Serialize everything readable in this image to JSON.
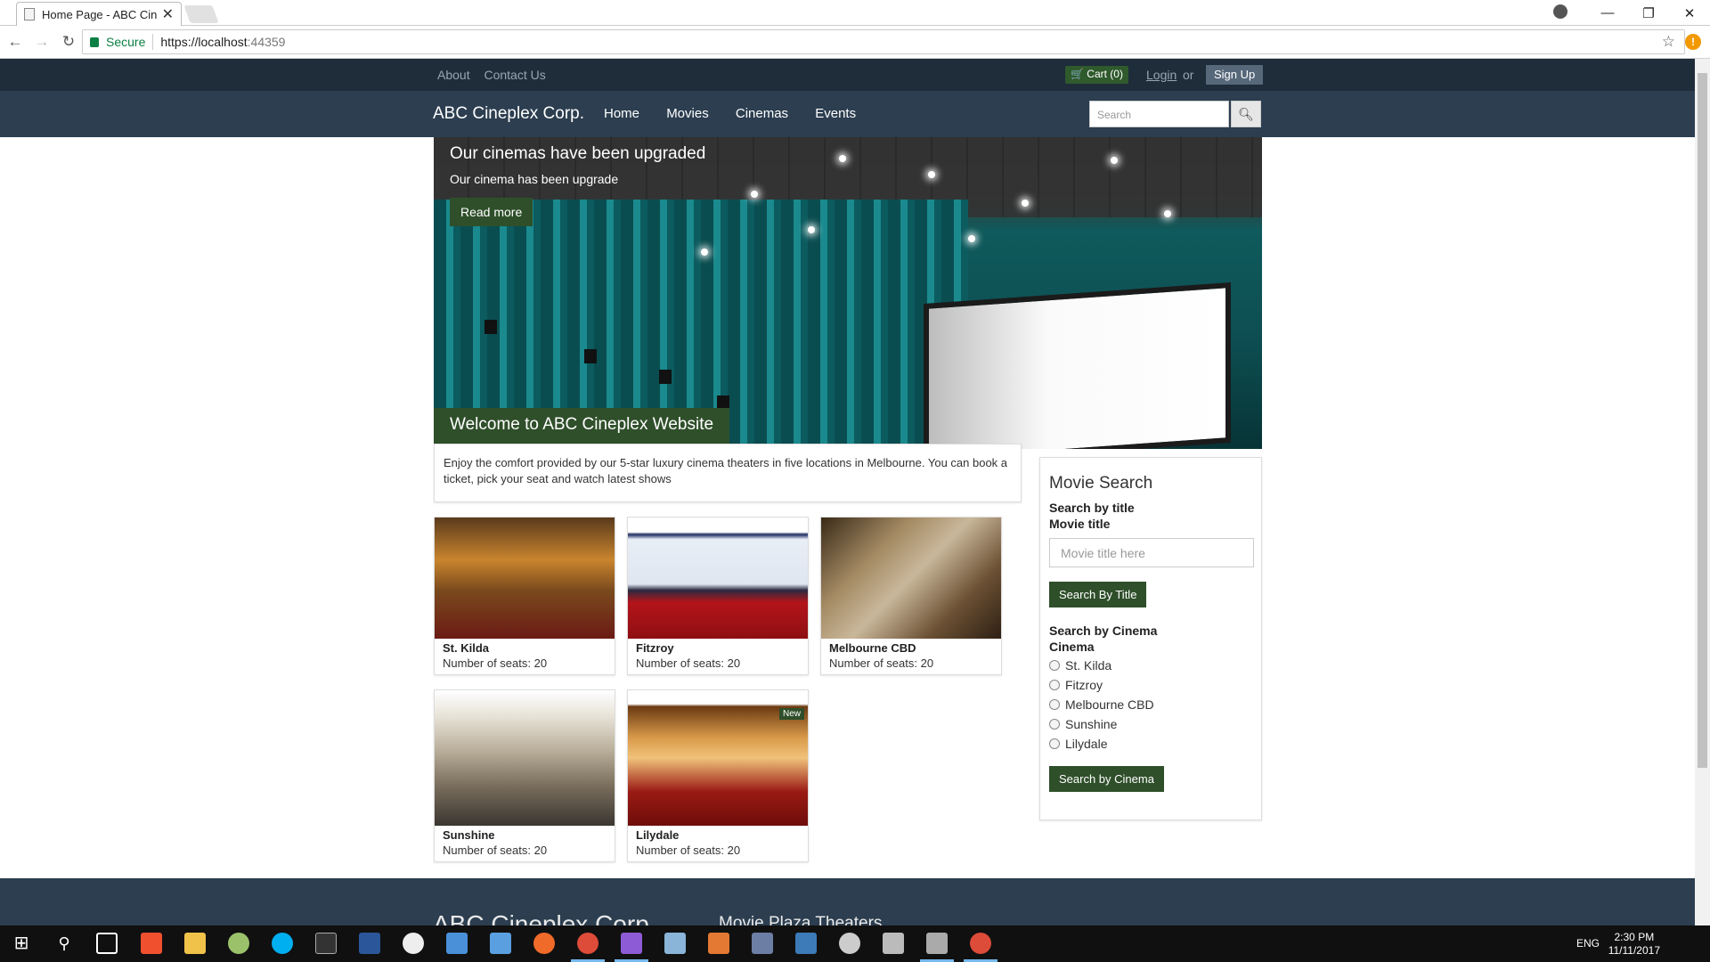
{
  "browser": {
    "tab_title": "Home Page - ABC Cinep",
    "close_glyph": "✕",
    "secure_label": "Secure",
    "url_host": "https://localhost",
    "url_port": ":44359"
  },
  "topbar": {
    "about": "About",
    "contact": "Contact Us",
    "cart": "Cart (0)",
    "login": "Login",
    "or": "or",
    "signup": "Sign Up"
  },
  "nav": {
    "brand": "ABC Cineplex Corp.",
    "items": [
      "Home",
      "Movies",
      "Cinemas",
      "Events"
    ],
    "search_placeholder": "Search"
  },
  "hero": {
    "title": "Our cinemas have been upgraded",
    "subtitle": "Our cinema has been upgrade",
    "read_more": "Read more",
    "welcome": "Welcome to ABC Cineplex Website"
  },
  "intro": "Enjoy the comfort provided by our 5-star luxury cinema theaters in five locations in Melbourne. You can book a ticket, pick your seat and watch latest shows",
  "cinemas": [
    {
      "name": "St. Kilda",
      "seats": "Number of seats: 20",
      "new": ""
    },
    {
      "name": "Fitzroy",
      "seats": "Number of seats: 20",
      "new": ""
    },
    {
      "name": "Melbourne CBD",
      "seats": "Number of seats: 20",
      "new": ""
    },
    {
      "name": "Sunshine",
      "seats": "Number of seats: 20",
      "new": ""
    },
    {
      "name": "Lilydale",
      "seats": "Number of seats: 20",
      "new": "New"
    }
  ],
  "search_panel": {
    "heading": "Movie Search",
    "by_title": "Search by title",
    "movie_title_label": "Movie title",
    "title_placeholder": "Movie title here",
    "title_button": "Search By Title",
    "by_cinema": "Search by Cinema",
    "cinema_label": "Cinema",
    "options": [
      "St. Kilda",
      "Fitzroy",
      "Melbourne CBD",
      "Sunshine",
      "Lilydale"
    ],
    "cinema_button": "Search by Cinema"
  },
  "footer": {
    "brand": "ABC Cineplex Corp.",
    "theaters": "Movie Plaza Theaters"
  },
  "taskbar": {
    "lang": "ENG",
    "time": "2:30 PM",
    "date": "11/11/2017"
  }
}
